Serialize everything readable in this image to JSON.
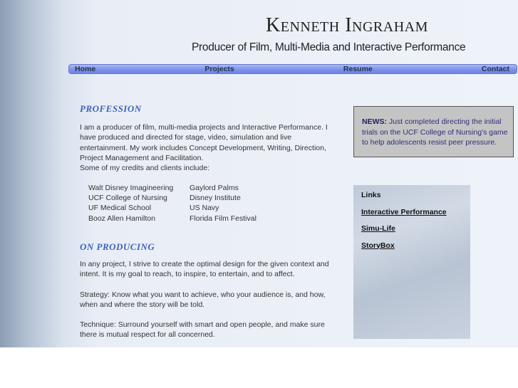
{
  "header": {
    "title": "Kenneth Ingraham",
    "subtitle": "Producer of Film, Multi-Media and Interactive Performance"
  },
  "nav": [
    "Home",
    "Projects",
    "Resume",
    "Contact"
  ],
  "profession": {
    "heading": "PROFESSION",
    "intro": "I am a producer of film, multi-media projects and Interactive Performance. I have produced and directed for stage, video, simulation and live entertainment. My work includes Concept Development, Writing, Direction, Project Management and Facilitation.",
    "credits_intro": "Some of my credits and clients include:",
    "credits": [
      "Walt Disney Imagineering",
      "Gaylord Palms",
      "UCF College of Nursing",
      "Disney Institute",
      "UF Medical School",
      "US Navy",
      "Booz Allen Hamilton",
      "Florida Film Festival"
    ]
  },
  "producing": {
    "heading": "ON PRODUCING",
    "paragraphs": [
      "In any project, I strive to create the optimal design for the given context and intent. It is my goal to reach, to inspire, to entertain, and to affect.",
      "Strategy: Know what you want to achieve, who your audience is, and how, when and where the story will be told.",
      "Technique: Surround yourself with smart and open people, and make sure there is mutual respect for all concerned."
    ]
  },
  "news": {
    "label": "NEWS:",
    "text": " Just completed directing the initial trials on the UCF College of Nursing's game to help adolescents resist peer pressure."
  },
  "links": {
    "heading": "Links",
    "items": [
      "Interactive Performance",
      "Simu-Life",
      "StoryBox"
    ]
  }
}
